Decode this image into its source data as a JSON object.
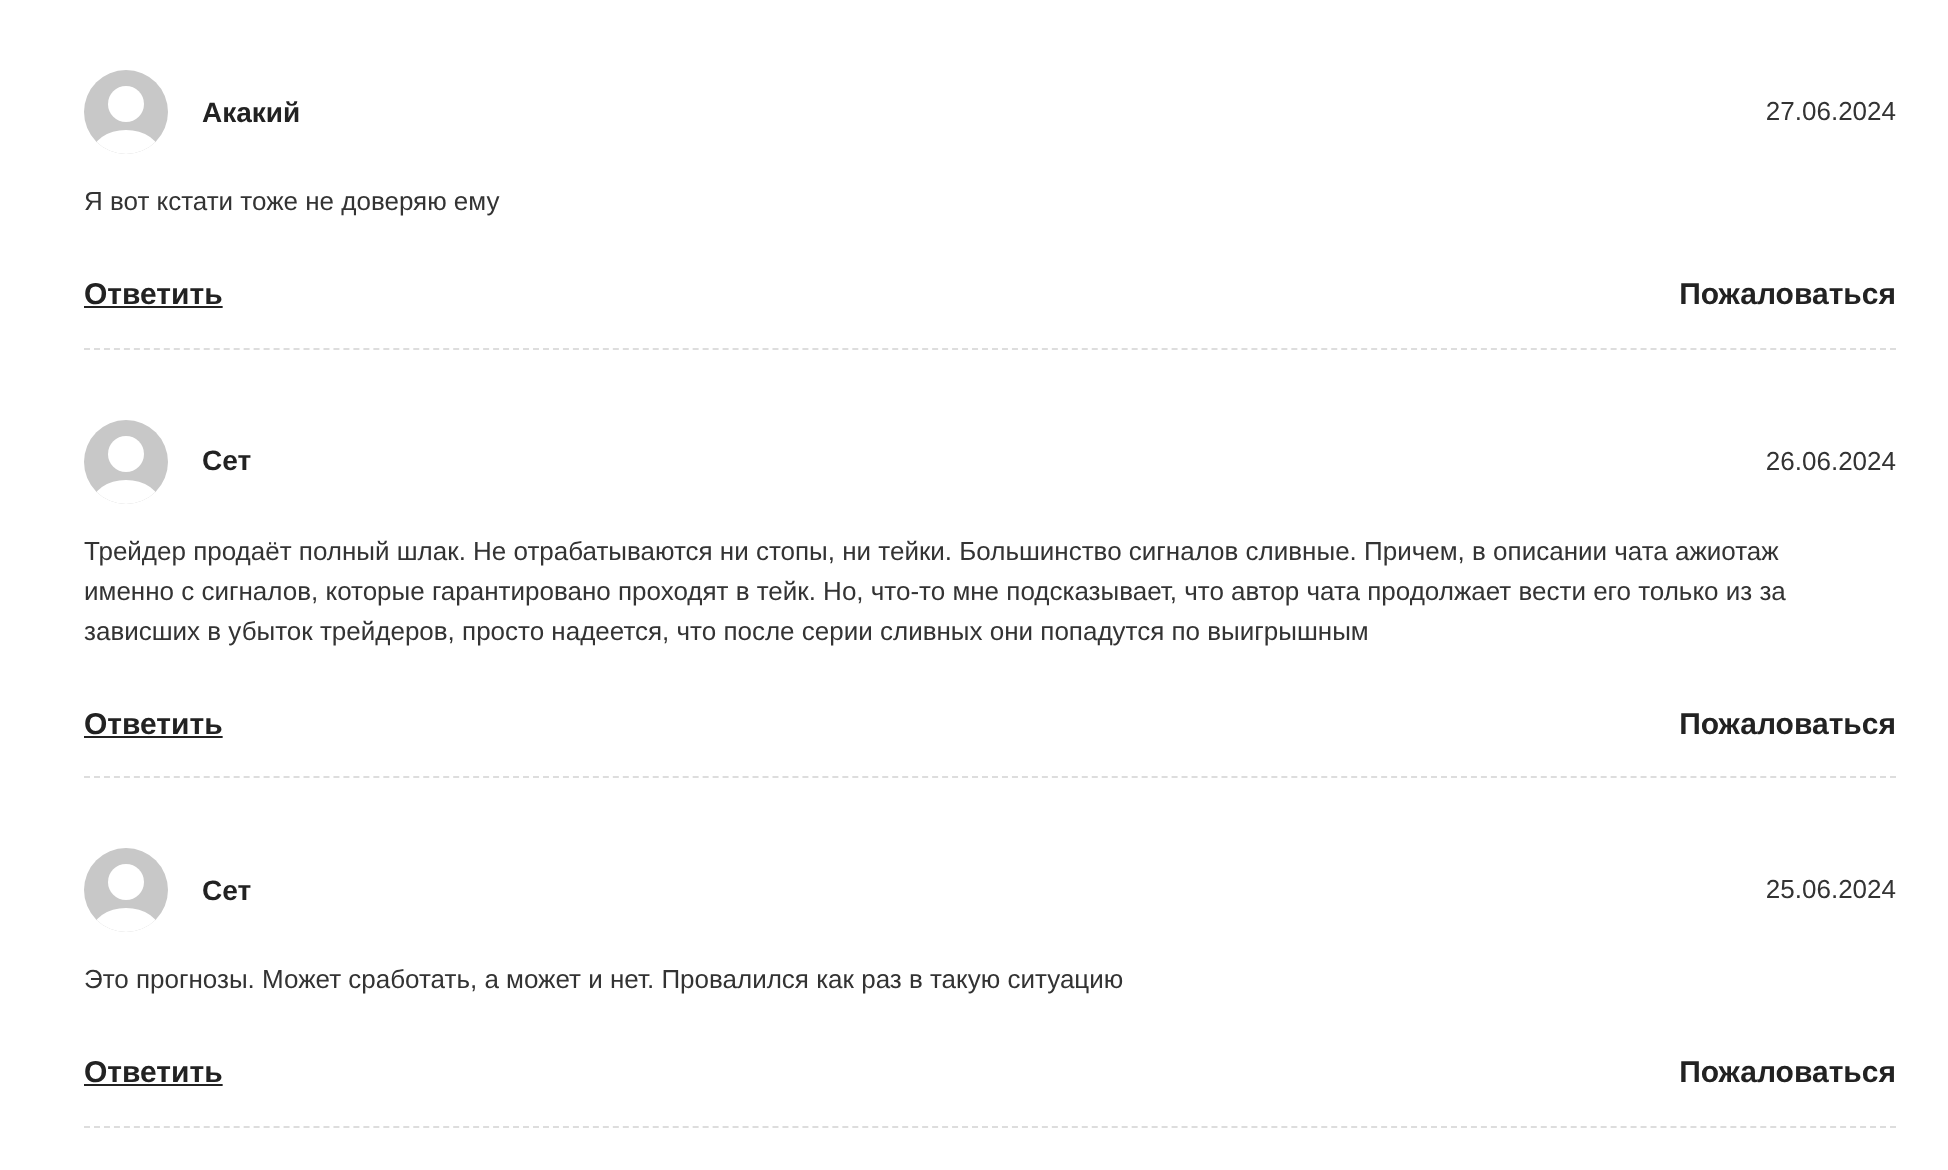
{
  "comments": [
    {
      "author": "Акакий",
      "date": "27.06.2024",
      "text": "Я вот кстати тоже не доверяю ему",
      "reply": "Ответить",
      "report": "Пожаловаться"
    },
    {
      "author": "Сет",
      "date": "26.06.2024",
      "text": "Трейдер продаёт полный шлак. Не отрабатываются ни стопы, ни тейки. Большинство сигналов сливные. Причем, в описании чата ажиотаж именно с сигналов, которые гарантировано проходят в тейк. Но, что-то мне подсказывает, что автор чата продолжает вести его только из за зависших в убыток трейдеров, просто надеется, что после серии сливных они попадутся по выигрышным",
      "reply": "Ответить",
      "report": "Пожаловаться"
    },
    {
      "author": "Сет",
      "date": "25.06.2024",
      "text": "Это прогнозы. Может сработать, а может и нет. Провалился как раз в такую ситуацию",
      "reply": "Ответить",
      "report": "Пожаловаться"
    }
  ]
}
